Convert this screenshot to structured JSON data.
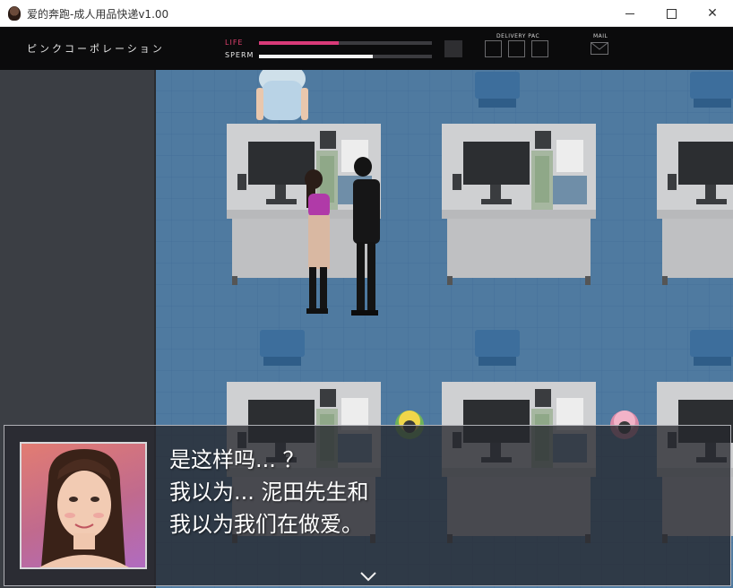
{
  "window": {
    "title": "爱的奔跑-成人用品快递v1.00",
    "icon": "character-app-icon",
    "minimize_icon": "minimize-icon",
    "maximize_icon": "maximize-icon",
    "close_label": "✕"
  },
  "hud": {
    "company_name": "ピンクコーポレーション",
    "life": {
      "label": "LIFE",
      "level": 0.46,
      "color": "#d93a78"
    },
    "sperm": {
      "label": "SPERM",
      "level": 0.66,
      "color": "#f4f4f4"
    },
    "delivery": {
      "label": "DELIVERY PAC",
      "slots": 3
    },
    "mail": {
      "label": "MAIL",
      "icon": "envelope-icon"
    }
  },
  "scene": {
    "floor_color": "#4f7aa0",
    "wall_color": "#3b3e44",
    "icons": [
      "yellow-flower-npc-icon",
      "pink-flower-npc-icon"
    ]
  },
  "dialog": {
    "lines": [
      "是这样吗... ？",
      "我以为... 泥田先生和",
      "我以为我们在做爱。"
    ],
    "portrait": "woman-portrait",
    "continue_icon": "chevron-down-icon"
  }
}
